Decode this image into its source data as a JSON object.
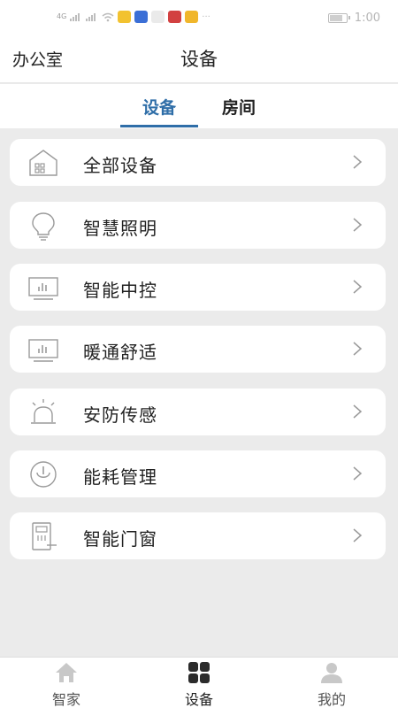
{
  "status_bar": {
    "network": "4G",
    "time": "1:00"
  },
  "header": {
    "location": "办公室",
    "title": "设备"
  },
  "tabs": [
    {
      "label": "设备",
      "active": true
    },
    {
      "label": "房间",
      "active": false
    }
  ],
  "categories": [
    {
      "label": "全部设备",
      "icon": "house-icon"
    },
    {
      "label": "智慧照明",
      "icon": "lightbulb-icon"
    },
    {
      "label": "智能中控",
      "icon": "monitor-chart-icon"
    },
    {
      "label": "暖通舒适",
      "icon": "monitor-chart-icon"
    },
    {
      "label": "安防传感",
      "icon": "alarm-light-icon"
    },
    {
      "label": "能耗管理",
      "icon": "power-meter-icon"
    },
    {
      "label": "智能门窗",
      "icon": "door-lock-icon"
    }
  ],
  "bottom_nav": [
    {
      "label": "智家",
      "icon": "home-icon",
      "active": false
    },
    {
      "label": "设备",
      "icon": "grid-icon",
      "active": true
    },
    {
      "label": "我的",
      "icon": "person-icon",
      "active": false
    }
  ],
  "colors": {
    "accent": "#2f6ea8",
    "background": "#ebebeb",
    "card": "#ffffff"
  }
}
